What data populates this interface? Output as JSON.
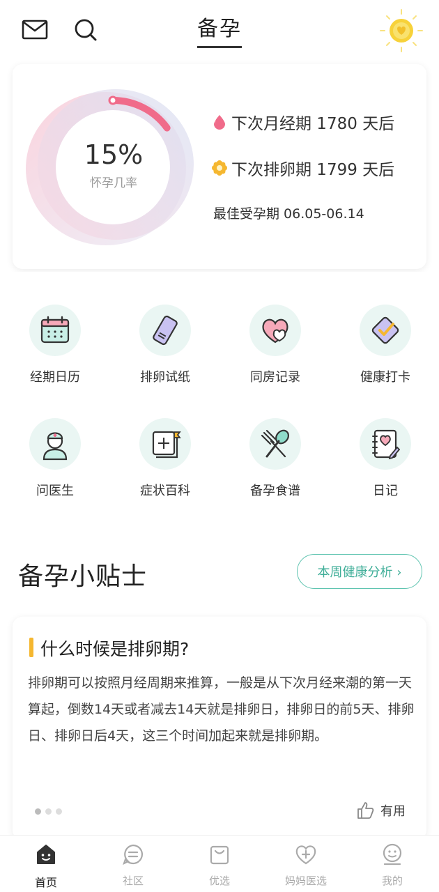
{
  "header": {
    "title": "备孕",
    "icons": [
      "mail-icon",
      "search-icon",
      "sun-coin-icon"
    ]
  },
  "summary": {
    "rate": "15%",
    "rate_label": "怀孕几率",
    "rate_fraction": 0.15,
    "next_period": "下次月经期 1780 天后",
    "next_ovulation": "下次排卵期 1799 天后",
    "best_window": "最佳受孕期 06.05-06.14",
    "colors": {
      "period": "#f06b8a",
      "ovulation": "#f5b730",
      "ring": "#f06b8a"
    }
  },
  "features": [
    {
      "label": "经期日历",
      "icon": "calendar-icon"
    },
    {
      "label": "排卵试纸",
      "icon": "test-strip-icon"
    },
    {
      "label": "同房记录",
      "icon": "hearts-icon"
    },
    {
      "label": "健康打卡",
      "icon": "checkmark-card-icon"
    },
    {
      "label": "问医生",
      "icon": "doctor-icon"
    },
    {
      "label": "症状百科",
      "icon": "encyclopedia-icon"
    },
    {
      "label": "备孕食谱",
      "icon": "fork-spoon-icon"
    },
    {
      "label": "日记",
      "icon": "diary-icon"
    }
  ],
  "tips": {
    "title": "备孕小贴士",
    "analysis_button": "本周健康分析 ›",
    "question": "什么时候是排卵期?",
    "body": "排卵期可以按照月经周期来推算，一般是从下次月经来潮的第一天算起，倒数14天或者减去14天就是排卵日，排卵日的前5天、排卵日、排卵日后4天，这三个时间加起来就是排卵期。",
    "useful_label": "有用",
    "accent": "#5fc4b0"
  },
  "tabbar": [
    {
      "label": "首页",
      "icon": "home-icon",
      "active": true
    },
    {
      "label": "社区",
      "icon": "chat-icon",
      "active": false
    },
    {
      "label": "优选",
      "icon": "bag-icon",
      "active": false
    },
    {
      "label": "妈妈医选",
      "icon": "heart-plus-icon",
      "active": false
    },
    {
      "label": "我的",
      "icon": "smiley-icon",
      "active": false
    }
  ]
}
